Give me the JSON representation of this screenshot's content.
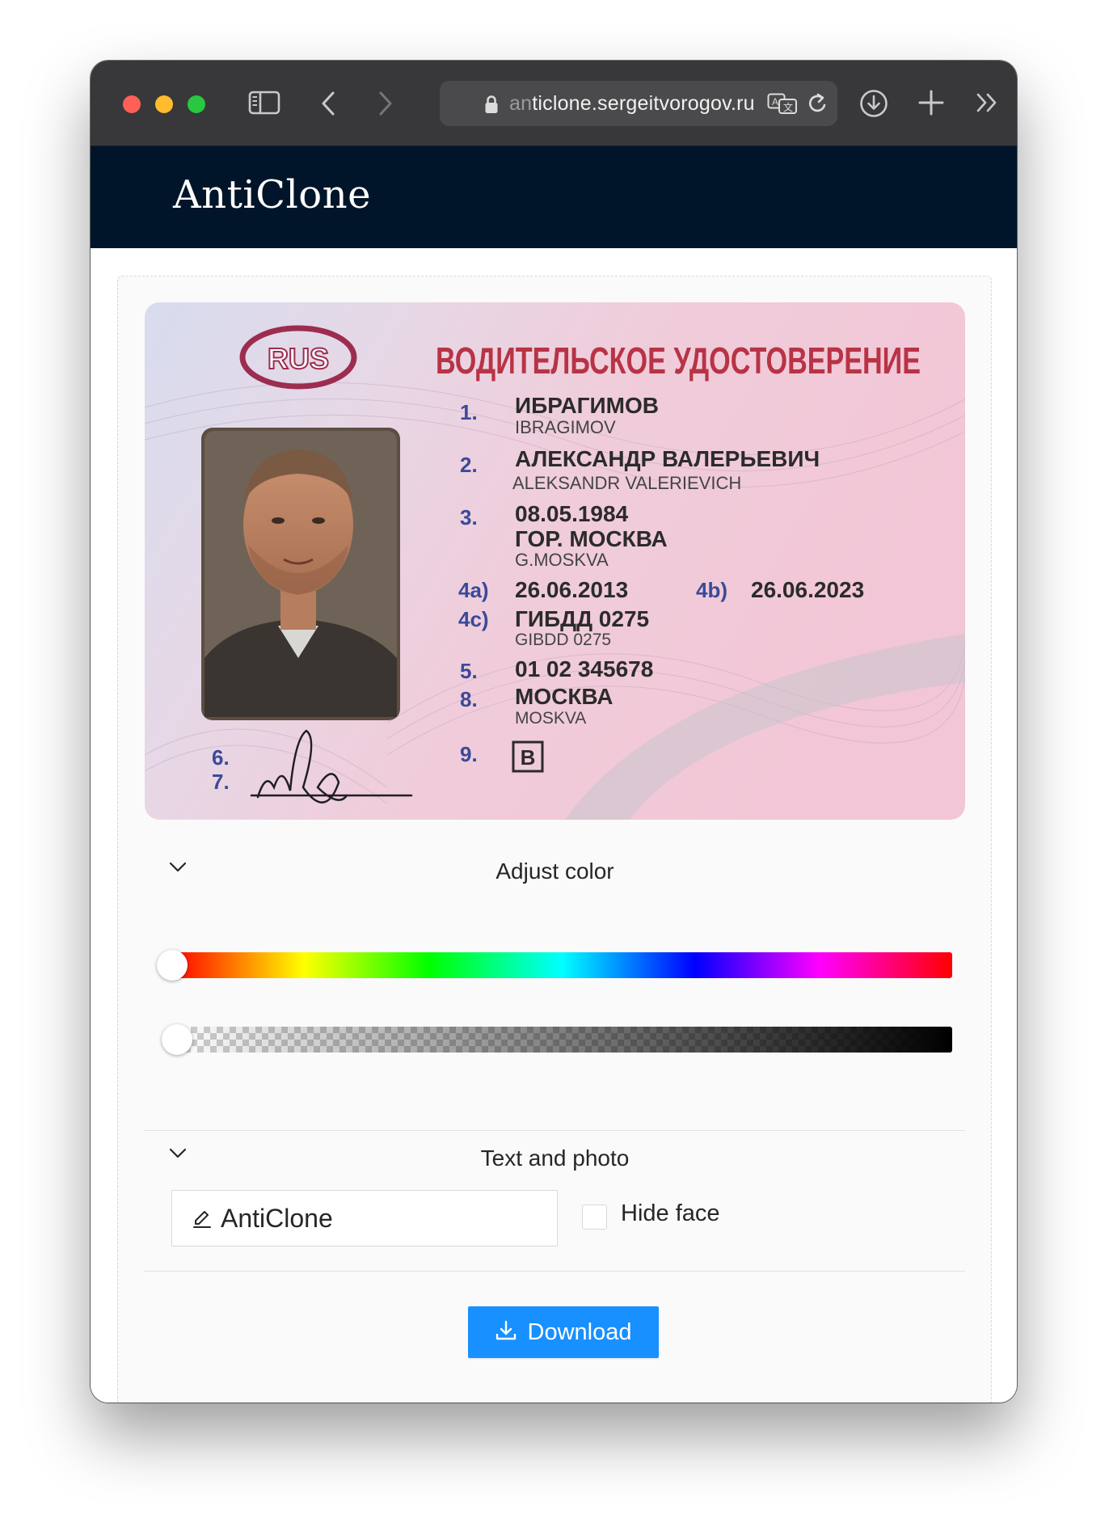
{
  "browser": {
    "url_faded": "an",
    "url": "ticlone.sergeitvorogov.ru"
  },
  "site": {
    "brand": "AntiClone"
  },
  "license": {
    "country": "RUS",
    "heading": "ВОДИТЕЛЬСКОЕ УДОСТОВЕРЕНИЕ",
    "fields": [
      {
        "num": "1.",
        "value": "ИБРАГИМОВ",
        "latin": "IBRAGIMOV"
      },
      {
        "num": "2.",
        "value": "АЛЕКСАНДР ВАЛЕРЬЕВИЧ",
        "latin": "ALEKSANDR VALERIEVICH"
      },
      {
        "num": "3.",
        "value": "08.05.1984",
        "value2": "ГОР. МОСКВА",
        "latin": "G.MOSKVA"
      },
      {
        "num": "4a)",
        "value": "26.06.2013",
        "num_b": "4b)",
        "value_b": "26.06.2023"
      },
      {
        "num": "4c)",
        "value": "ГИБДД 0275",
        "latin": "GIBDD 0275"
      },
      {
        "num": "5.",
        "value": "01 02 345678"
      },
      {
        "num": "8.",
        "value": "МОСКВА",
        "latin": "MOSKVA"
      },
      {
        "num": "9.",
        "value": "B"
      }
    ],
    "sig_labels": [
      "6.",
      "7."
    ]
  },
  "adjust_color": {
    "title": "Adjust color",
    "hue_value": 0,
    "alpha_value": 0
  },
  "text_photo": {
    "title": "Text and photo",
    "text_value": "AntiClone",
    "hide_face_label": "Hide face",
    "hide_face_checked": false
  },
  "download": {
    "label": "Download"
  },
  "colors": {
    "header_bg": "#001529",
    "primary": "#1890ff",
    "license_red": "#b83346",
    "license_blue": "#3a4a9a"
  },
  "icons": [
    "sidebar-icon",
    "back-icon",
    "forward-icon",
    "lock-icon",
    "translate-icon",
    "reload-icon",
    "downloads-icon",
    "new-tab-icon",
    "more-icon",
    "chevron-down-icon",
    "edit-icon",
    "download-icon"
  ]
}
